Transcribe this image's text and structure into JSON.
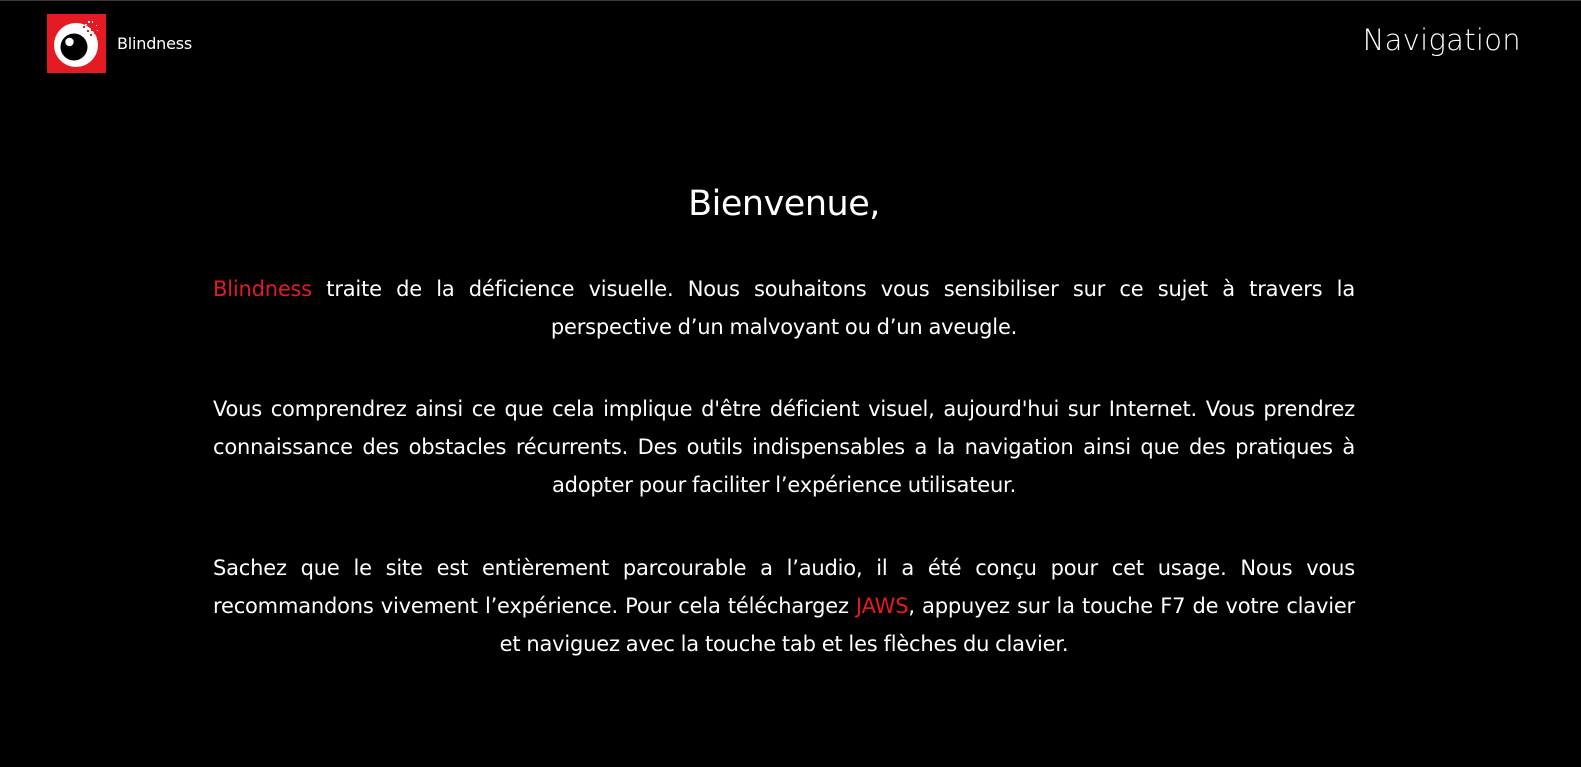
{
  "header": {
    "logo_text": "Blindness",
    "nav_label": "Navigation"
  },
  "colors": {
    "background": "#000000",
    "accent": "#e41b23",
    "text": "#ffffff"
  },
  "icons": {
    "logo": "eye-icon"
  },
  "main": {
    "heading": "Bienvenue,",
    "p1": {
      "brand": "Blindness",
      "text": " traite de la déficience visuelle. Nous souhaitons vous sensibiliser sur ce sujet à travers la perspective d’un malvoyant ou d’un aveugle."
    },
    "p2": {
      "text": "Vous comprendrez ainsi ce que cela implique d'être déficient visuel, aujourd'hui sur Internet. Vous prendrez connaissance des obstacles récurrents. Des outils indispensables a la navigation ainsi que des pratiques à adopter pour faciliter l’expérience utilisateur."
    },
    "p3": {
      "text_before": "Sachez que le site est entièrement parcourable a l’audio, il a été conçu pour cet usage. Nous vous recommandons vivement l’expérience. Pour cela téléchargez ",
      "link": "JAWS",
      "text_after": ", appuyez sur la touche F7 de votre clavier et naviguez avec la touche tab et les flèches du clavier."
    }
  }
}
